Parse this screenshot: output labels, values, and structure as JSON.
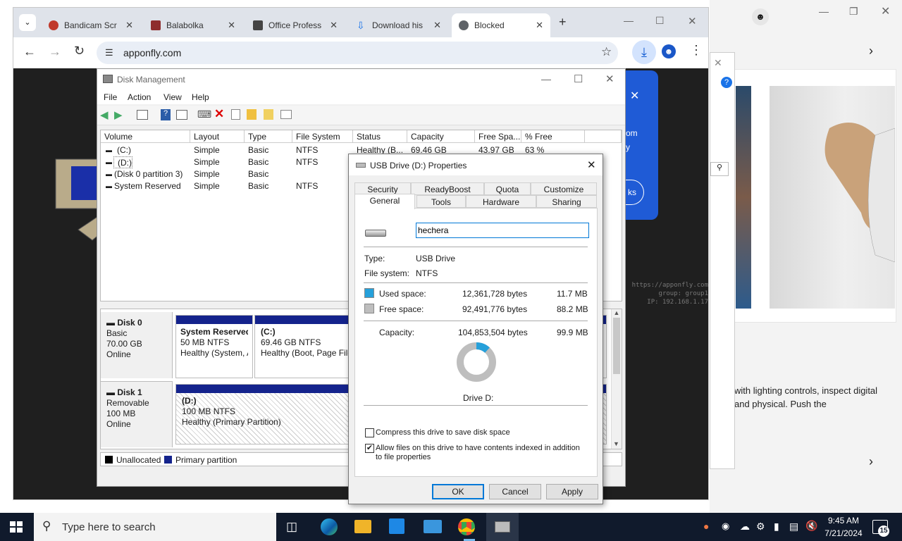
{
  "browser": {
    "tabs": [
      {
        "label": "Bandicam Scr",
        "icon_color": "#c0392b"
      },
      {
        "label": "Balabolka",
        "icon_color": "#8e2d2d"
      },
      {
        "label": "Office Profess",
        "icon_color": "#444444"
      },
      {
        "label": "Download his",
        "icon_color": "#1a73e8"
      },
      {
        "label": "Blocked",
        "icon_color": "#5f6368"
      }
    ],
    "url": "apponfly.com"
  },
  "watermark": {
    "line1": "https://apponfly.com",
    "line2": "group: group1",
    "line3": "IP: 192.168.1.17"
  },
  "popup": {
    "text1": "om",
    "text2": "y",
    "button": "ks"
  },
  "background_page": {
    "text": "with lighting controls, inspect digital and physical. Push the"
  },
  "disk_mgmt": {
    "title": "Disk Management",
    "menu": [
      "File",
      "Action",
      "View",
      "Help"
    ],
    "columns": [
      "Volume",
      "Layout",
      "Type",
      "File System",
      "Status",
      "Capacity",
      "Free Spa...",
      "% Free"
    ],
    "volumes": [
      {
        "volume": "(C:)",
        "layout": "Simple",
        "type": "Basic",
        "fs": "NTFS",
        "status": "Healthy (B...",
        "capacity": "69.46 GB",
        "free": "43.97 GB",
        "pct": "63 %"
      },
      {
        "volume": "(D:)",
        "layout": "Simple",
        "type": "Basic",
        "fs": "NTFS",
        "status": "",
        "capacity": "",
        "free": "",
        "pct": ""
      },
      {
        "volume": "(Disk 0 partition 3)",
        "layout": "Simple",
        "type": "Basic",
        "fs": "",
        "status": "",
        "capacity": "",
        "free": "",
        "pct": ""
      },
      {
        "volume": "System Reserved",
        "layout": "Simple",
        "type": "Basic",
        "fs": "NTFS",
        "status": "",
        "capacity": "",
        "free": "",
        "pct": ""
      }
    ],
    "disk0": {
      "name": "Disk 0",
      "kind": "Basic",
      "size": "70.00 GB",
      "state": "Online",
      "p1_name": "System Reserved",
      "p1_size": "50 MB NTFS",
      "p1_status": "Healthy (System, A",
      "p2_name": "(C:)",
      "p2_size": "69.46 GB NTFS",
      "p2_status": "Healthy (Boot, Page File,"
    },
    "disk1": {
      "name": "Disk 1",
      "kind": "Removable",
      "size": "100 MB",
      "state": "Online",
      "p1_name": "(D:)",
      "p1_size": "100 MB NTFS",
      "p1_status": "Healthy (Primary Partition)"
    },
    "legend": {
      "unallocated": "Unallocated",
      "primary": "Primary partition"
    }
  },
  "dialog": {
    "title": "USB Drive (D:) Properties",
    "tabs_row1": [
      "Security",
      "ReadyBoost",
      "Quota",
      "Customize"
    ],
    "tabs_row2": [
      "General",
      "Tools",
      "Hardware",
      "Sharing"
    ],
    "name_value": "hechera",
    "type_label": "Type:",
    "type_value": "USB Drive",
    "fs_label": "File system:",
    "fs_value": "NTFS",
    "used_label": "Used space:",
    "used_bytes": "12,361,728 bytes",
    "used_mb": "11.7 MB",
    "free_label": "Free space:",
    "free_bytes": "92,491,776 bytes",
    "free_mb": "88.2 MB",
    "cap_label": "Capacity:",
    "cap_bytes": "104,853,504 bytes",
    "cap_mb": "99.9 MB",
    "used_fraction": 0.118,
    "drive_label": "Drive D:",
    "compress_label": "Compress this drive to save disk space",
    "compress_checked": false,
    "index_label": "Allow files on this drive to have contents indexed in addition to file properties",
    "index_checked": true,
    "ok": "OK",
    "cancel": "Cancel",
    "apply": "Apply",
    "used_color": "#26a0da",
    "free_color": "#bebebe"
  },
  "taskbar": {
    "search_placeholder": "Type here to search",
    "time": "9:45 AM",
    "date": "7/21/2024",
    "notif_count": "15"
  }
}
